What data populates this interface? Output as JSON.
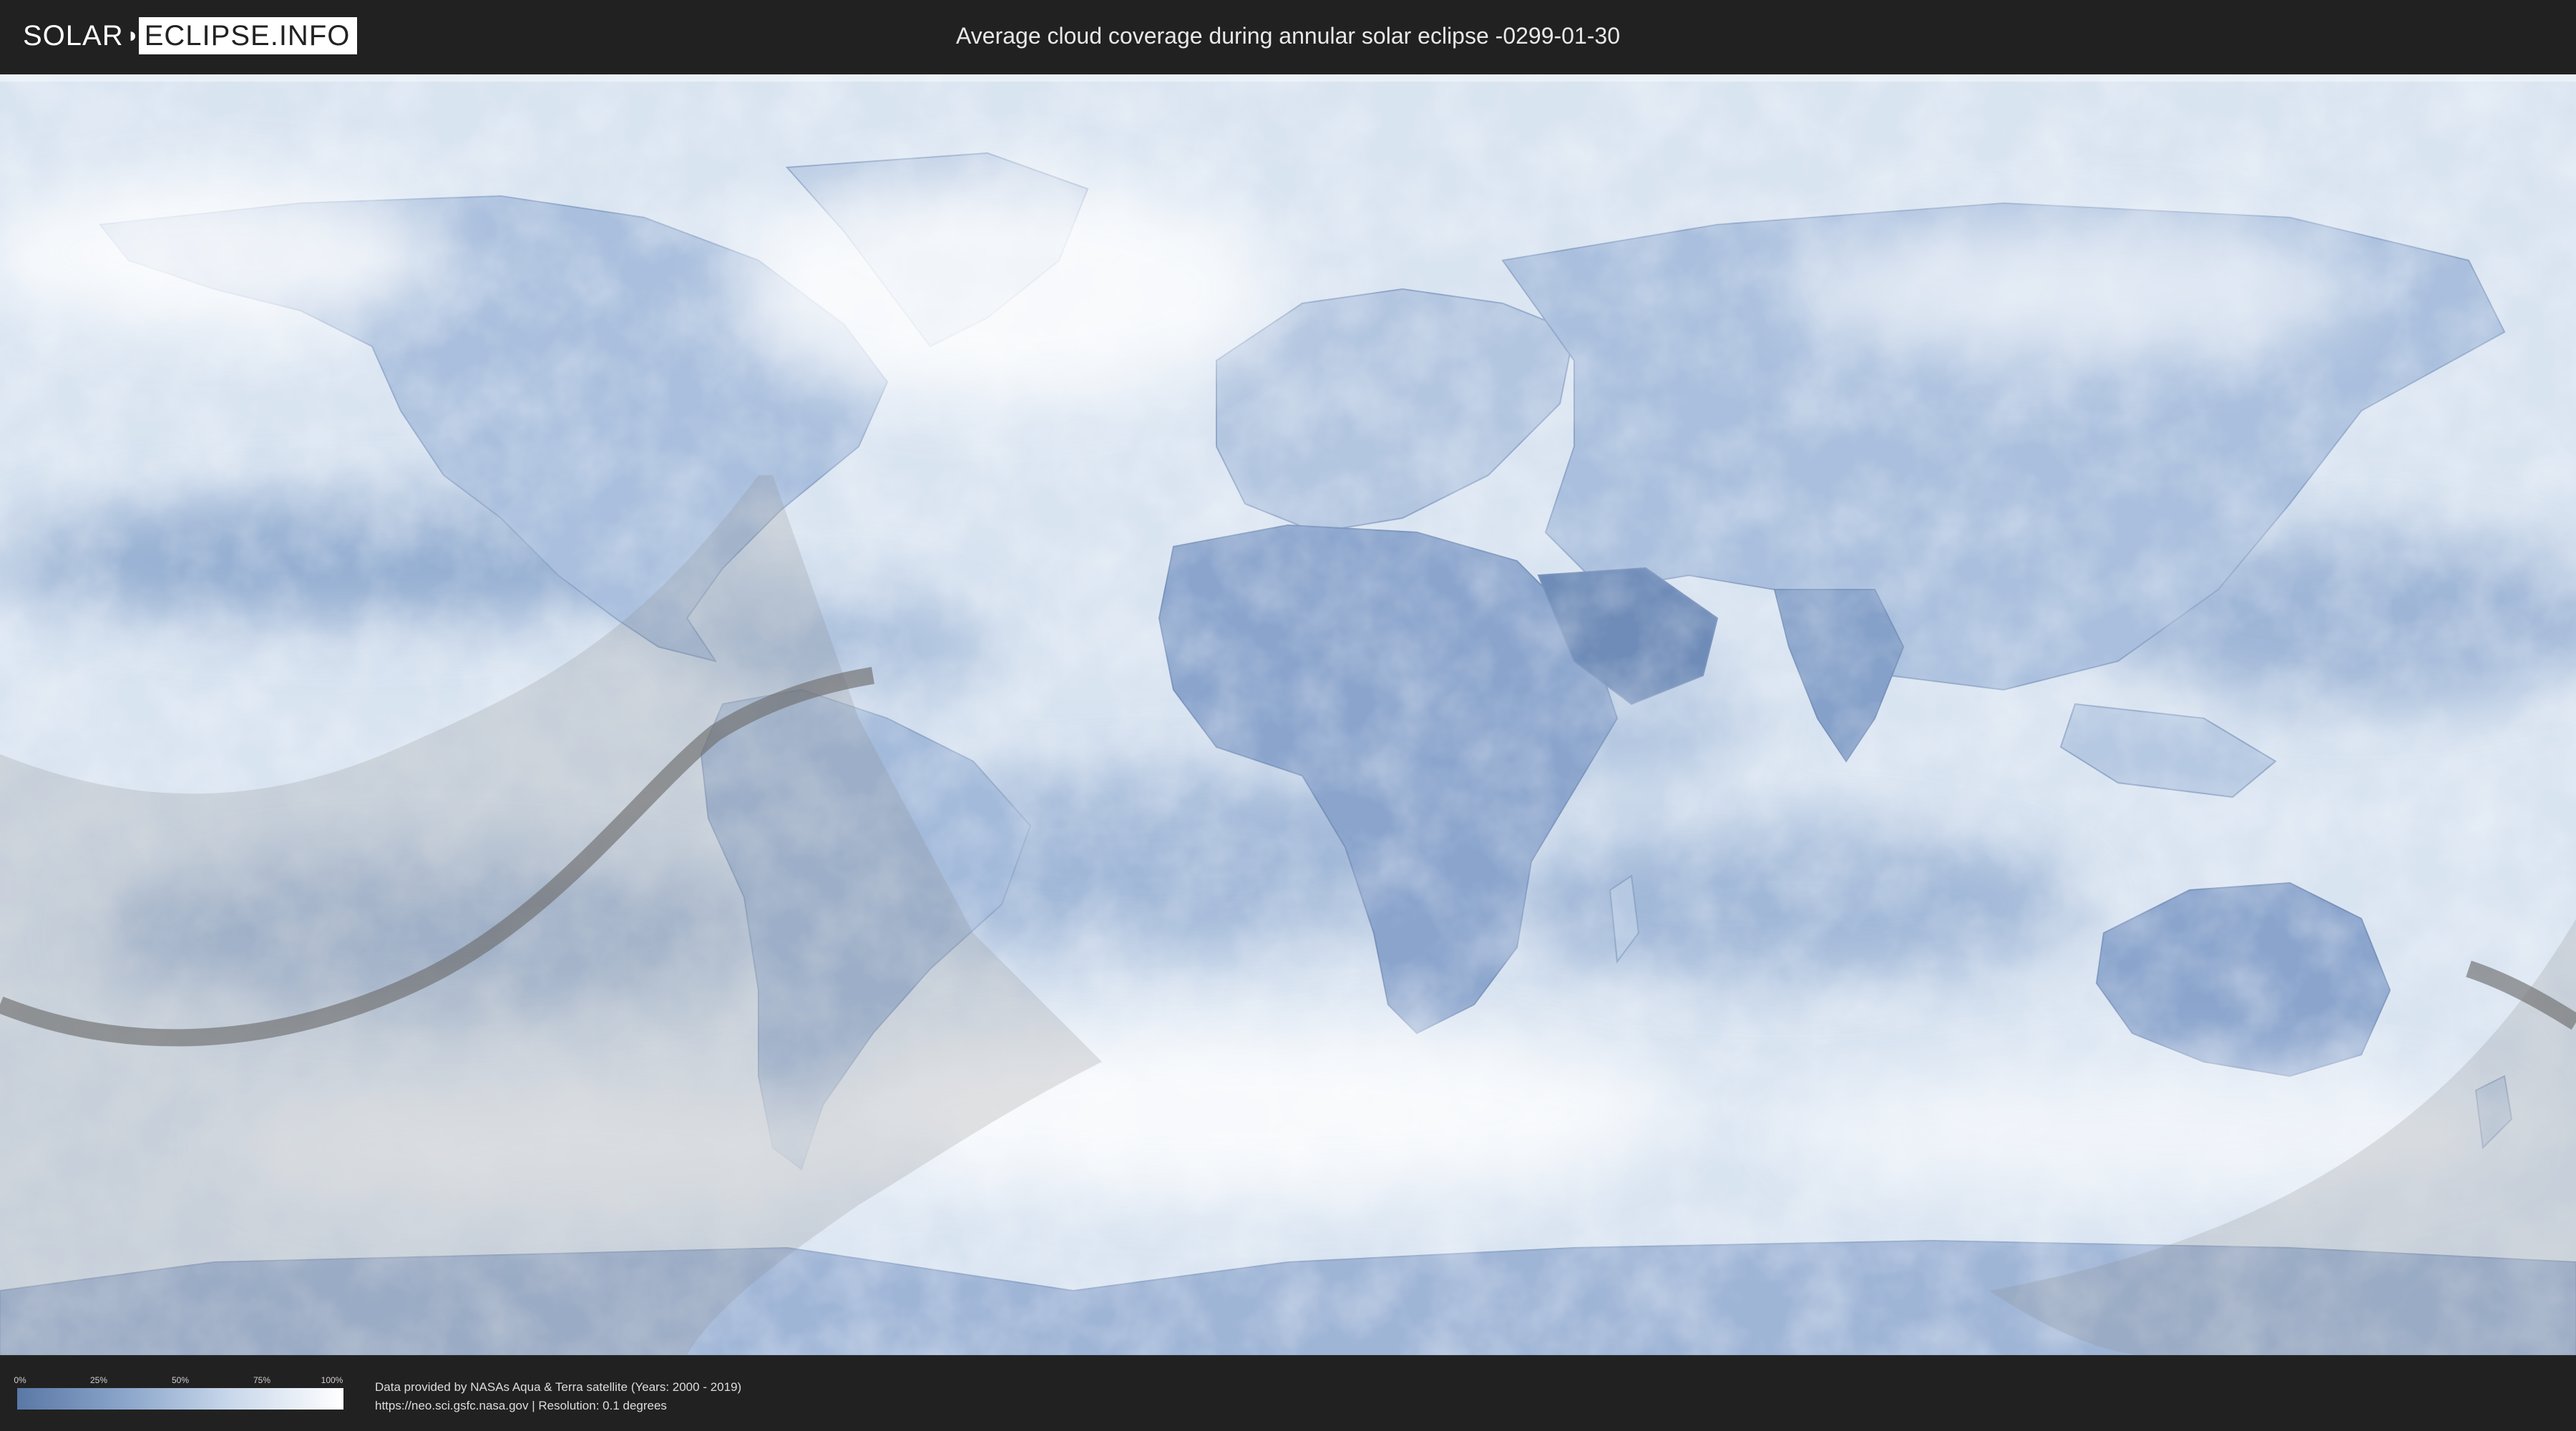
{
  "header": {
    "logo_left": "SOLAR",
    "logo_right": "ECLIPSE.INFO",
    "title": "Average cloud coverage during annular solar eclipse -0299-01-30"
  },
  "legend": {
    "ticks": [
      "0%",
      "25%",
      "50%",
      "75%",
      "100%"
    ],
    "gradient_colors": [
      "#5a78a6",
      "#8ea8cc",
      "#c8d7ea",
      "#ffffff"
    ]
  },
  "credits": {
    "line1": "Data provided by NASAs Aqua & Terra satellite (Years: 2000 - 2019)",
    "line2": "https://neo.sci.gsfc.nasa.gov | Resolution: 0.1 degrees"
  },
  "map": {
    "projection": "equirectangular",
    "ocean_color": "#dfe9f4",
    "land_clear_color": "#6f8cb8",
    "cloudy_color": "#ffffff",
    "penumbra_color": "#9a9a9a",
    "central_path_color": "#707070"
  }
}
